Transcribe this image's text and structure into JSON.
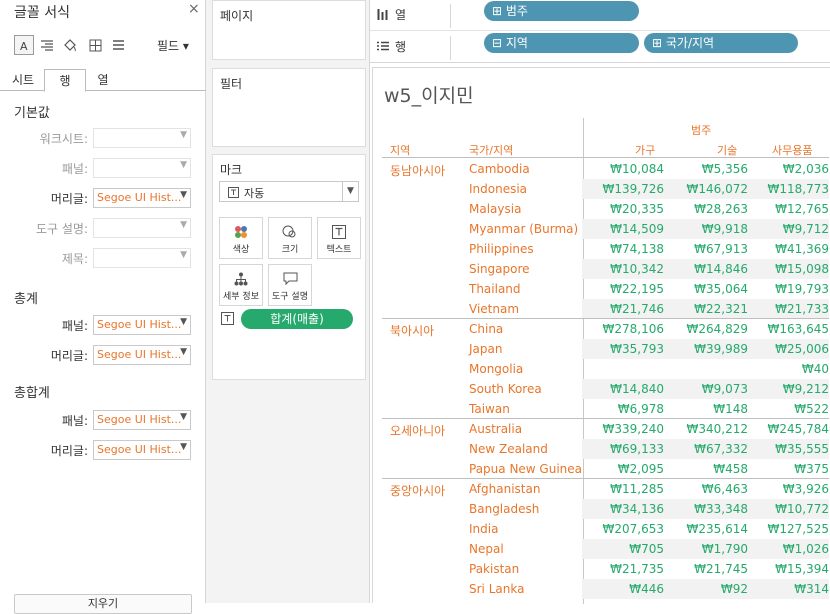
{
  "format_pane": {
    "title": "글꼴 서식",
    "field_button": "필드 ▾",
    "tabs": [
      "시트",
      "행",
      "열"
    ],
    "active_tab": "행",
    "sections": {
      "default": {
        "label": "기본값",
        "rows": [
          {
            "label": "워크시트:",
            "value": "",
            "enabled": false
          },
          {
            "label": "패널:",
            "value": "",
            "enabled": false
          },
          {
            "label": "머리글:",
            "value": "Segoe UI Hist...",
            "enabled": true
          },
          {
            "label": "도구 설명:",
            "value": "",
            "enabled": false
          },
          {
            "label": "제목:",
            "value": "",
            "enabled": false
          }
        ]
      },
      "total": {
        "label": "총계",
        "rows": [
          {
            "label": "패널:",
            "value": "Segoe UI Hist..."
          },
          {
            "label": "머리글:",
            "value": "Segoe UI Hist..."
          }
        ]
      },
      "grand_total": {
        "label": "총합계",
        "rows": [
          {
            "label": "패널:",
            "value": "Segoe UI Hist..."
          },
          {
            "label": "머리글:",
            "value": "Segoe UI Hist..."
          }
        ]
      }
    },
    "bottom_button": "지우기"
  },
  "cards": {
    "pages": "페이지",
    "filters": "필터",
    "marks": {
      "title": "마크",
      "mark_type": "자동",
      "buttons": [
        "색상",
        "크기",
        "텍스트",
        "세부 정보",
        "도구 설명"
      ],
      "pill": "합계(매출)"
    }
  },
  "shelves": {
    "columns": {
      "label": "열",
      "pills": [
        "범주"
      ]
    },
    "rows": {
      "label": "행",
      "pills": [
        "지역",
        "국가/지역"
      ]
    }
  },
  "view": {
    "sheet_title": "w5_이지민",
    "header_group": "범주",
    "headers": {
      "region": "지역",
      "country": "국가/지역",
      "c1": "가구",
      "c2": "기술",
      "c3": "사무용품"
    },
    "groups": [
      {
        "region": "동남아시아",
        "rows": [
          {
            "country": "Cambodia",
            "v": [
              "₩10,084",
              "₩5,356",
              "₩2,036"
            ]
          },
          {
            "country": "Indonesia",
            "v": [
              "₩139,726",
              "₩146,072",
              "₩118,773"
            ]
          },
          {
            "country": "Malaysia",
            "v": [
              "₩20,335",
              "₩28,263",
              "₩12,765"
            ]
          },
          {
            "country": "Myanmar (Burma)",
            "v": [
              "₩14,509",
              "₩9,918",
              "₩9,712"
            ]
          },
          {
            "country": "Philippines",
            "v": [
              "₩74,138",
              "₩67,913",
              "₩41,369"
            ]
          },
          {
            "country": "Singapore",
            "v": [
              "₩10,342",
              "₩14,846",
              "₩15,098"
            ]
          },
          {
            "country": "Thailand",
            "v": [
              "₩22,195",
              "₩35,064",
              "₩19,793"
            ]
          },
          {
            "country": "Vietnam",
            "v": [
              "₩21,746",
              "₩22,321",
              "₩21,733"
            ]
          }
        ]
      },
      {
        "region": "북아시아",
        "rows": [
          {
            "country": "China",
            "v": [
              "₩278,106",
              "₩264,829",
              "₩163,645"
            ]
          },
          {
            "country": "Japan",
            "v": [
              "₩35,793",
              "₩39,989",
              "₩25,006"
            ]
          },
          {
            "country": "Mongolia",
            "v": [
              "",
              "",
              "₩40"
            ]
          },
          {
            "country": "South Korea",
            "v": [
              "₩14,840",
              "₩9,073",
              "₩9,212"
            ]
          },
          {
            "country": "Taiwan",
            "v": [
              "₩6,978",
              "₩148",
              "₩522"
            ]
          }
        ]
      },
      {
        "region": "오세아니아",
        "rows": [
          {
            "country": "Australia",
            "v": [
              "₩339,240",
              "₩340,212",
              "₩245,784"
            ]
          },
          {
            "country": "New Zealand",
            "v": [
              "₩69,133",
              "₩67,332",
              "₩35,555"
            ]
          },
          {
            "country": "Papua New Guinea",
            "v": [
              "₩2,095",
              "₩458",
              "₩375"
            ]
          }
        ]
      },
      {
        "region": "중앙아시아",
        "rows": [
          {
            "country": "Afghanistan",
            "v": [
              "₩11,285",
              "₩6,463",
              "₩3,926"
            ]
          },
          {
            "country": "Bangladesh",
            "v": [
              "₩34,136",
              "₩33,348",
              "₩10,772"
            ]
          },
          {
            "country": "India",
            "v": [
              "₩207,653",
              "₩235,614",
              "₩127,525"
            ]
          },
          {
            "country": "Nepal",
            "v": [
              "₩705",
              "₩1,790",
              "₩1,026"
            ]
          },
          {
            "country": "Pakistan",
            "v": [
              "₩21,735",
              "₩21,745",
              "₩15,394"
            ]
          },
          {
            "country": "Sri Lanka",
            "v": [
              "₩446",
              "₩92",
              "₩314"
            ]
          }
        ]
      }
    ]
  },
  "colors": {
    "header_orange": "#e8762b",
    "value_green": "#26a96c",
    "pill_blue": "#4e95b2",
    "pill_green": "#26a96c"
  }
}
